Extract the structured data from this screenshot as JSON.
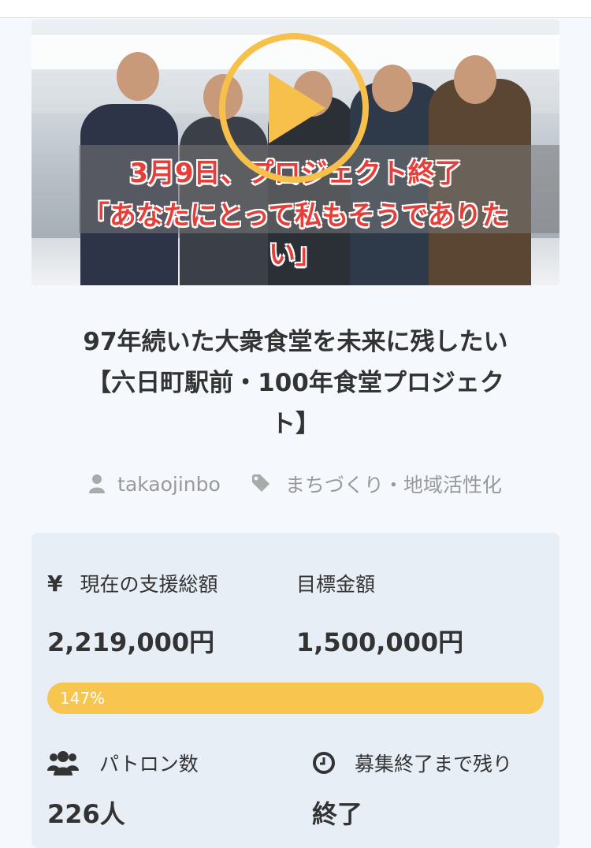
{
  "video": {
    "caption_line1": "3月9日、プロジェクト終了",
    "caption_line2": "「あなたにとって私もそうでありたい」",
    "play_icon": "play-icon"
  },
  "project": {
    "title_line1": "97年続いた大衆食堂を未来に残したい",
    "title_line2": "【六日町駅前・100年食堂プロジェク",
    "title_line3": "ト】",
    "owner": "takaojinbo",
    "category": "まちづくり・地域活性化"
  },
  "stats": {
    "currency_icon": "yen-icon",
    "current_label": "現在の支援総額",
    "current_value": "2,219,000円",
    "goal_label": "目標金額",
    "goal_value": "1,500,000円",
    "progress_percent": "147%",
    "progress_fraction": 1.0,
    "patrons_icon": "users-icon",
    "patrons_label": "パトロン数",
    "patrons_value": "226人",
    "remaining_icon": "clock-icon",
    "remaining_label": "募集終了まで残り",
    "remaining_value": "終了"
  },
  "colors": {
    "accent": "#f8c64f",
    "caption_red": "#e63e39",
    "panel_bg": "#e7eef6",
    "meta_gray": "#999999"
  }
}
